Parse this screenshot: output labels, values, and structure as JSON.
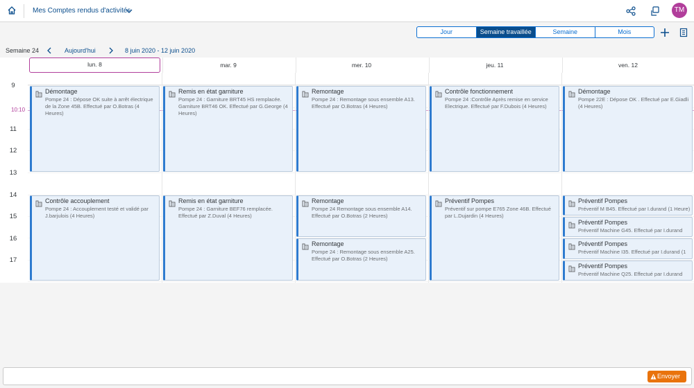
{
  "shell": {
    "title": "Mes Comptes rendus d'activités",
    "avatar_initials": "TM"
  },
  "views": [
    {
      "label": "Jour",
      "active": false
    },
    {
      "label": "Semaine travaillée",
      "active": true
    },
    {
      "label": "Semaine",
      "active": false
    },
    {
      "label": "Mois",
      "active": false
    }
  ],
  "nav": {
    "week_label": "Semaine 24",
    "today_label": "Aujourd'hui",
    "date_range": "8 juin 2020 - 12 juin 2020"
  },
  "days": [
    "lun.  8",
    "mar.  9",
    "mer.  10",
    "jeu.  11",
    "ven.  12"
  ],
  "hours": [
    "9",
    "11",
    "12",
    "13",
    "14",
    "15",
    "16",
    "17"
  ],
  "now_label": "10:10",
  "appointments": [
    {
      "day": 0,
      "start": 9,
      "end": 13,
      "title": "Démontage",
      "desc": "Pompe 24 : Dépose OK suite à arrêt électrique de la Zone 45B. Effectué par O.Botras (4 Heures)"
    },
    {
      "day": 0,
      "start": 14,
      "end": 18,
      "title": "Contrôle accouplement",
      "desc": "Pompe 24 : Accouplement testé et validé par J.barjulois (4 Heures)"
    },
    {
      "day": 1,
      "start": 9,
      "end": 13,
      "title": "Remis en état garniture",
      "desc": "Pompe 24 : Garniture BRT45 HS remplacée. Garniture BRT46 OK. Effectué par G.George (4 Heures)"
    },
    {
      "day": 1,
      "start": 14,
      "end": 18,
      "title": "Remis en état garniture",
      "desc": "Pompe 24 : Garniture BEF76 remplacée. Effectué par Z.Duval (4 Heures)"
    },
    {
      "day": 2,
      "start": 9,
      "end": 13,
      "title": "Remontage",
      "desc": "Pompe 24 : Remontage sous ensemble A13. Effectué par O.Botras (4 Heures)"
    },
    {
      "day": 2,
      "start": 14,
      "end": 16,
      "title": "Remontage",
      "desc": "Pompe 24 Remontage sous ensemble A14. Effectué par O.Botras (2 Heures)"
    },
    {
      "day": 2,
      "start": 16,
      "end": 18,
      "title": "Remontage",
      "desc": "Pompe 24 : Remontage sous ensemble A25. Effectué par O.Botras (2 Heures)"
    },
    {
      "day": 3,
      "start": 9,
      "end": 13,
      "title": "Contrôle fonctionnement",
      "desc": "Pompe 24 :Contrôle Après remise en service Electrique. Effectué par F.Dubois (4 Heures)"
    },
    {
      "day": 3,
      "start": 14,
      "end": 18,
      "title": "Préventif Pompes",
      "desc": "Préventif sur pompe E765 Zone 46B. Effectué par L.Dujardin (4 Heures)"
    },
    {
      "day": 4,
      "start": 9,
      "end": 13,
      "title": "Démontage",
      "desc": "Pompe 22E : Dépose OK . Effectué par E.Giadli (4 Heures)"
    },
    {
      "day": 4,
      "start": 14,
      "end": 15,
      "title": "Préventif Pompes",
      "desc": "Préventif M B45. Effectué par I.durand (1 Heure)"
    },
    {
      "day": 4,
      "start": 15,
      "end": 16,
      "title": "Préventif Pompes",
      "desc": "Préventif Machine G45. Effectué par I.durand"
    },
    {
      "day": 4,
      "start": 16,
      "end": 17,
      "title": "Préventif Pompes",
      "desc": "Préventif Machine I35. Effectué par I.durand (1"
    },
    {
      "day": 4,
      "start": 17,
      "end": 18,
      "title": "Préventif Pompes",
      "desc": "Préventif Machine Q25. Effectué par I.durand"
    }
  ],
  "footer": {
    "send_label": "Envoyer"
  },
  "colors": {
    "accent": "#0a4d8c",
    "appointment_bg": "#e9f1fa",
    "appointment_bar": "#2e7bcf",
    "now": "#b13e9b",
    "send": "#e9730c"
  }
}
